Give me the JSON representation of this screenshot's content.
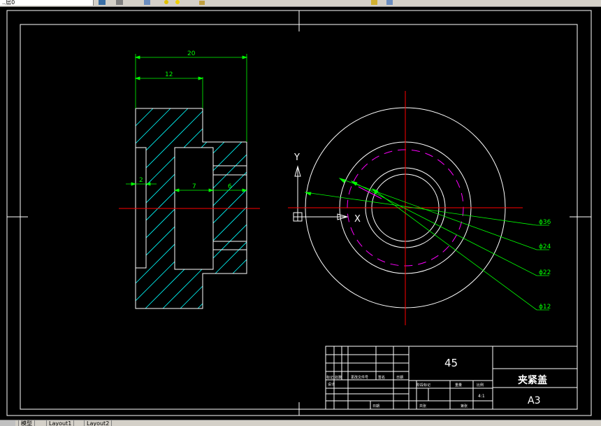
{
  "toolbar": {
    "layer_field": "..层0"
  },
  "tabs": {
    "model": "模型",
    "layout1": "Layout1",
    "layout2": "Layout2"
  },
  "drawing": {
    "dims": {
      "overall_width": "20",
      "step_width": "12",
      "hole_depth_1": "2",
      "hole_width": "7",
      "hole_depth_2": "6"
    },
    "ucs": {
      "y": "Y",
      "x": "X"
    },
    "diameters": [
      "ϕ36",
      "ϕ24",
      "ϕ22",
      "ϕ12"
    ]
  },
  "title_block": {
    "material": "45",
    "part_name": "夹紧盖",
    "paper_size": "A3",
    "scale": "4:1",
    "headers": {
      "mark": "标记",
      "count": "处数",
      "change_doc": "更改文件号",
      "signature": "签名",
      "date": "日期",
      "design": "设计",
      "stage_mark": "阶段标记",
      "weight": "重量",
      "ratio": "比例",
      "total_sheets": "共张",
      "sheet_no": "第张",
      "date2": "日期"
    }
  },
  "colors": {
    "border": "#ffffff",
    "dimension": "#00ff00",
    "hatch": "#00ffff",
    "center_line": "#ff0000",
    "hidden_circle": "#ff00ff"
  }
}
